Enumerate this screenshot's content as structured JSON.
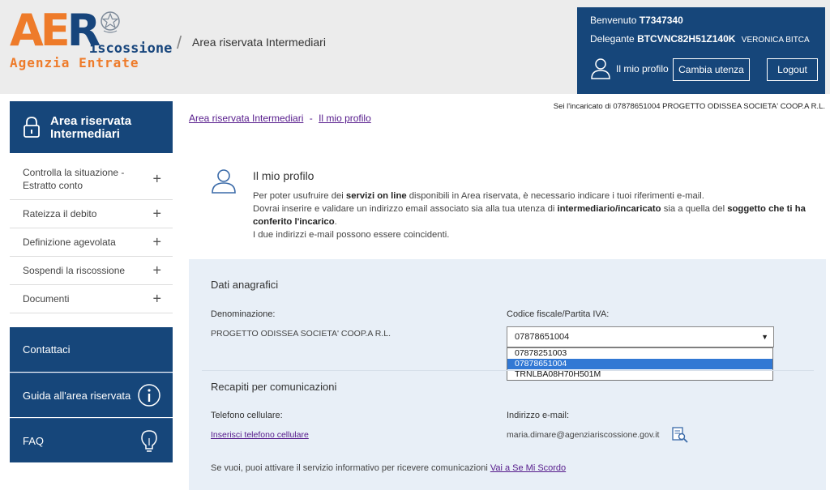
{
  "logo": {
    "big_text": "AER",
    "riscossione": "iscossione",
    "agenzia": "Agenzia Entrate"
  },
  "header": {
    "title": "Area riservata Intermediari"
  },
  "user": {
    "benvenuto_label": "Benvenuto",
    "benvenuto_code": "T7347340",
    "delegante_label": "Delegante",
    "delegante_code": "BTCVNC82H51Z140K",
    "delegante_name": "VERONICA BITCA",
    "profile_label": "Il mio profilo",
    "cambia_label": "Cambia utenza",
    "logout_label": "Logout"
  },
  "sidebar": {
    "header": "Area riservata Intermediari",
    "items": [
      {
        "label": "Controlla la situazione - Estratto conto"
      },
      {
        "label": "Rateizza il debito"
      },
      {
        "label": "Definizione agevolata"
      },
      {
        "label": "Sospendi la riscossione"
      },
      {
        "label": "Documenti"
      }
    ],
    "contattaci": "Contattaci",
    "guida": "Guida all'area riservata",
    "faq": "FAQ"
  },
  "breadcrumb": {
    "item1": "Area riservata Intermediari",
    "sep": "-",
    "item2": "Il mio profilo"
  },
  "incaricato": "Sei l'incaricato di 07878651004   PROGETTO ODISSEA SOCIETA' COOP.A R.L.",
  "profile": {
    "title": "Il mio profilo",
    "p1_a": "Per poter usufruire dei ",
    "p1_b": "servizi on line",
    "p1_c": " disponibili in Area riservata, è necessario indicare i tuoi riferimenti e-mail.",
    "p2_a": "Dovrai inserire e validare un indirizzo email associato sia alla tua utenza di ",
    "p2_b": "intermediario/incaricato",
    "p2_c": " sia a quella del ",
    "p2_d": "soggetto che ti ha conferito l'incarico",
    "p2_e": ".",
    "p3": "I due indirizzi e-mail possono essere coincidenti."
  },
  "anagrafici": {
    "title": "Dati anagrafici",
    "denominazione_label": "Denominazione:",
    "denominazione_value": "PROGETTO ODISSEA SOCIETA' COOP.A R.L.",
    "codice_label": "Codice fiscale/Partita IVA:",
    "codice_selected": "07878651004",
    "codice_options": [
      "07878251003",
      "07878651004",
      "TRNLBA08H70H501M"
    ]
  },
  "recapiti": {
    "title": "Recapiti per comunicazioni",
    "telefono_label": "Telefono cellulare:",
    "telefono_link": "Inserisci telefono cellulare",
    "email_label": "Indirizzo e-mail:",
    "email_value": "maria.dimare@agenziariscossione.gov.it",
    "info_text": "Se vuoi, puoi attivare il servizio informativo per ricevere comunicazioni ",
    "info_link": "Vai a Se Mi Scordo"
  },
  "colors": {
    "brand_blue": "#16467a",
    "brand_orange": "#ee7b2a",
    "panel_bg": "#e8eff7"
  }
}
